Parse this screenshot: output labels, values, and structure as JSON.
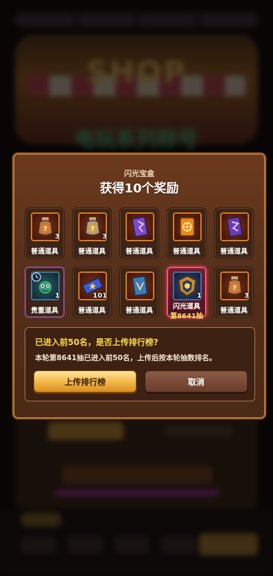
{
  "background": {
    "banner_text": "SHOP",
    "banner_subtitle": "电玩系列称号"
  },
  "modal": {
    "subtitle": "闪光宝盒",
    "title": "获得10个奖励",
    "rewards": [
      {
        "label": "普通道具",
        "count": "3",
        "icon": "potion-jar-icon",
        "rarity": "common"
      },
      {
        "label": "普通道具",
        "count": "3",
        "icon": "potion-jar-icon",
        "rarity": "common"
      },
      {
        "label": "普通道具",
        "count": "",
        "icon": "purple-card-icon",
        "rarity": "common"
      },
      {
        "label": "普通道具",
        "count": "",
        "icon": "orange-card-icon",
        "rarity": "common"
      },
      {
        "label": "普通道具",
        "count": "",
        "icon": "purple-card-icon",
        "rarity": "common"
      },
      {
        "label": "贵重道具",
        "count": "1",
        "icon": "green-creature-icon",
        "rarity": "rare"
      },
      {
        "label": "普通道具",
        "count": "101",
        "icon": "blue-ticket-icon",
        "rarity": "common"
      },
      {
        "label": "普通道具",
        "count": "",
        "icon": "blue-card-icon",
        "rarity": "common"
      },
      {
        "label": "闪光道具",
        "count": "1",
        "icon": "golden-crest-icon",
        "rarity": "flash",
        "draw": "第8641抽"
      },
      {
        "label": "普通道具",
        "count": "3",
        "icon": "potion-jar-icon",
        "rarity": "common"
      }
    ],
    "confirm": {
      "question": "已进入前50名，是否上传排行榜?",
      "detail": "本轮第8641抽已进入前50名，上传后按本轮抽数排名。",
      "upload_label": "上传排行榜",
      "cancel_label": "取消"
    }
  },
  "colors": {
    "accent_gold": "#f3b545",
    "highlight_yellow": "#ffd84a",
    "flash_red": "#e04060",
    "rare_purple": "#a85fb8"
  }
}
